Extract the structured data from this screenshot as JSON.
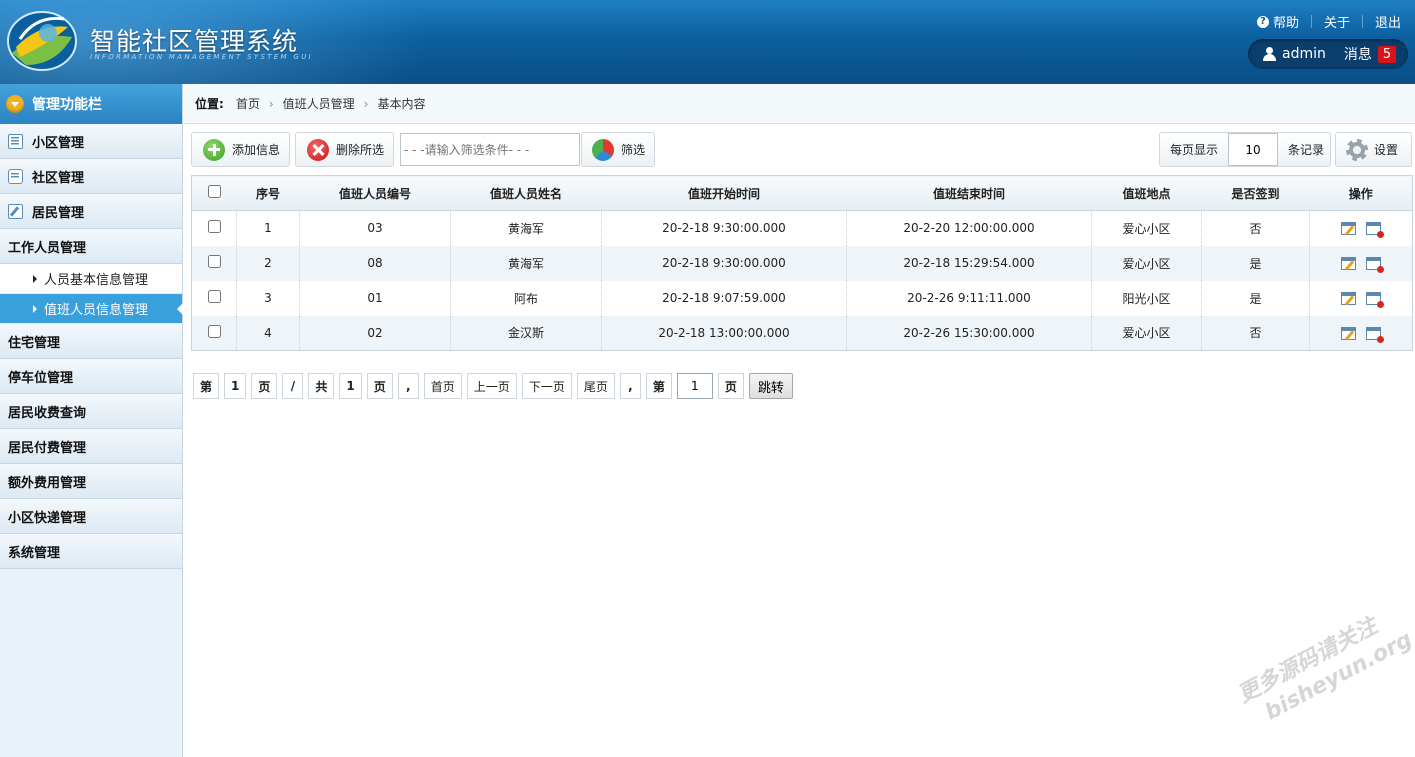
{
  "header": {
    "title": "智能社区管理系统",
    "subtitle": "INFORMATION MANAGEMENT SYSTEM GUI",
    "links": {
      "help": "帮助",
      "about": "关于",
      "logout": "退出"
    },
    "username": "admin",
    "messages_label": "消息",
    "messages_count": "5"
  },
  "sidebar": {
    "header": "管理功能栏",
    "items": [
      {
        "label": "小区管理",
        "icon": "list-icon"
      },
      {
        "label": "社区管理",
        "icon": "chat-icon"
      },
      {
        "label": "居民管理",
        "icon": "edit-icon"
      },
      {
        "label": "工作人员管理",
        "icon": "calendar-icon",
        "children": [
          {
            "label": "人员基本信息管理",
            "active": false
          },
          {
            "label": "值班人员信息管理",
            "active": true
          }
        ]
      },
      {
        "label": "住宅管理",
        "icon": "calendar-icon"
      },
      {
        "label": "停车位管理",
        "icon": "calendar-icon"
      },
      {
        "label": "居民收费查询",
        "icon": "calendar-icon"
      },
      {
        "label": "居民付费管理",
        "icon": "calendar-icon"
      },
      {
        "label": "额外费用管理",
        "icon": "calendar-icon"
      },
      {
        "label": "小区快递管理",
        "icon": "calendar-icon"
      },
      {
        "label": "系统管理",
        "icon": "calendar-icon"
      }
    ]
  },
  "breadcrumb": {
    "label": "位置:",
    "items": [
      "首页",
      "值班人员管理",
      "基本内容"
    ]
  },
  "toolbar": {
    "add_label": "添加信息",
    "delete_label": "删除所选",
    "filter_placeholder": "- - -请输入筛选条件- - -",
    "filter_label": "筛选",
    "per_page_label": "每页显示",
    "per_page_value": "10",
    "records_label": "条记录",
    "settings_label": "设置"
  },
  "table": {
    "columns": [
      "序号",
      "值班人员编号",
      "值班人员姓名",
      "值班开始时间",
      "值班结束时间",
      "值班地点",
      "是否签到",
      "操作"
    ],
    "rows": [
      [
        "1",
        "03",
        "黄海军",
        "20-2-18 9:30:00.000",
        "20-2-20 12:00:00.000",
        "爱心小区",
        "否"
      ],
      [
        "2",
        "08",
        "黄海军",
        "20-2-18 9:30:00.000",
        "20-2-18 15:29:54.000",
        "爱心小区",
        "是"
      ],
      [
        "3",
        "01",
        "阿布",
        "20-2-18 9:07:59.000",
        "20-2-26 9:11:11.000",
        "阳光小区",
        "是"
      ],
      [
        "4",
        "02",
        "金汉斯",
        "20-2-18 13:00:00.000",
        "20-2-26 15:30:00.000",
        "爱心小区",
        "否"
      ]
    ]
  },
  "pager": {
    "di": "第",
    "current_page": "1",
    "ye": "页",
    "slash": "/",
    "gong": "共",
    "total_pages": "1",
    "ye2": "页",
    "comma": ",",
    "first": "首页",
    "prev": "上一页",
    "next": "下一页",
    "last": "尾页",
    "comma2": ",",
    "di2": "第",
    "jump_value": "1",
    "ye3": "页",
    "go": "跳转"
  },
  "watermark": {
    "line1": "更多源码请关注",
    "line2": "bisheyun.org"
  },
  "colors": {
    "header_blue": "#0b5f9e",
    "active_blue": "#3aa0dc",
    "badge_red": "#d8141a"
  }
}
